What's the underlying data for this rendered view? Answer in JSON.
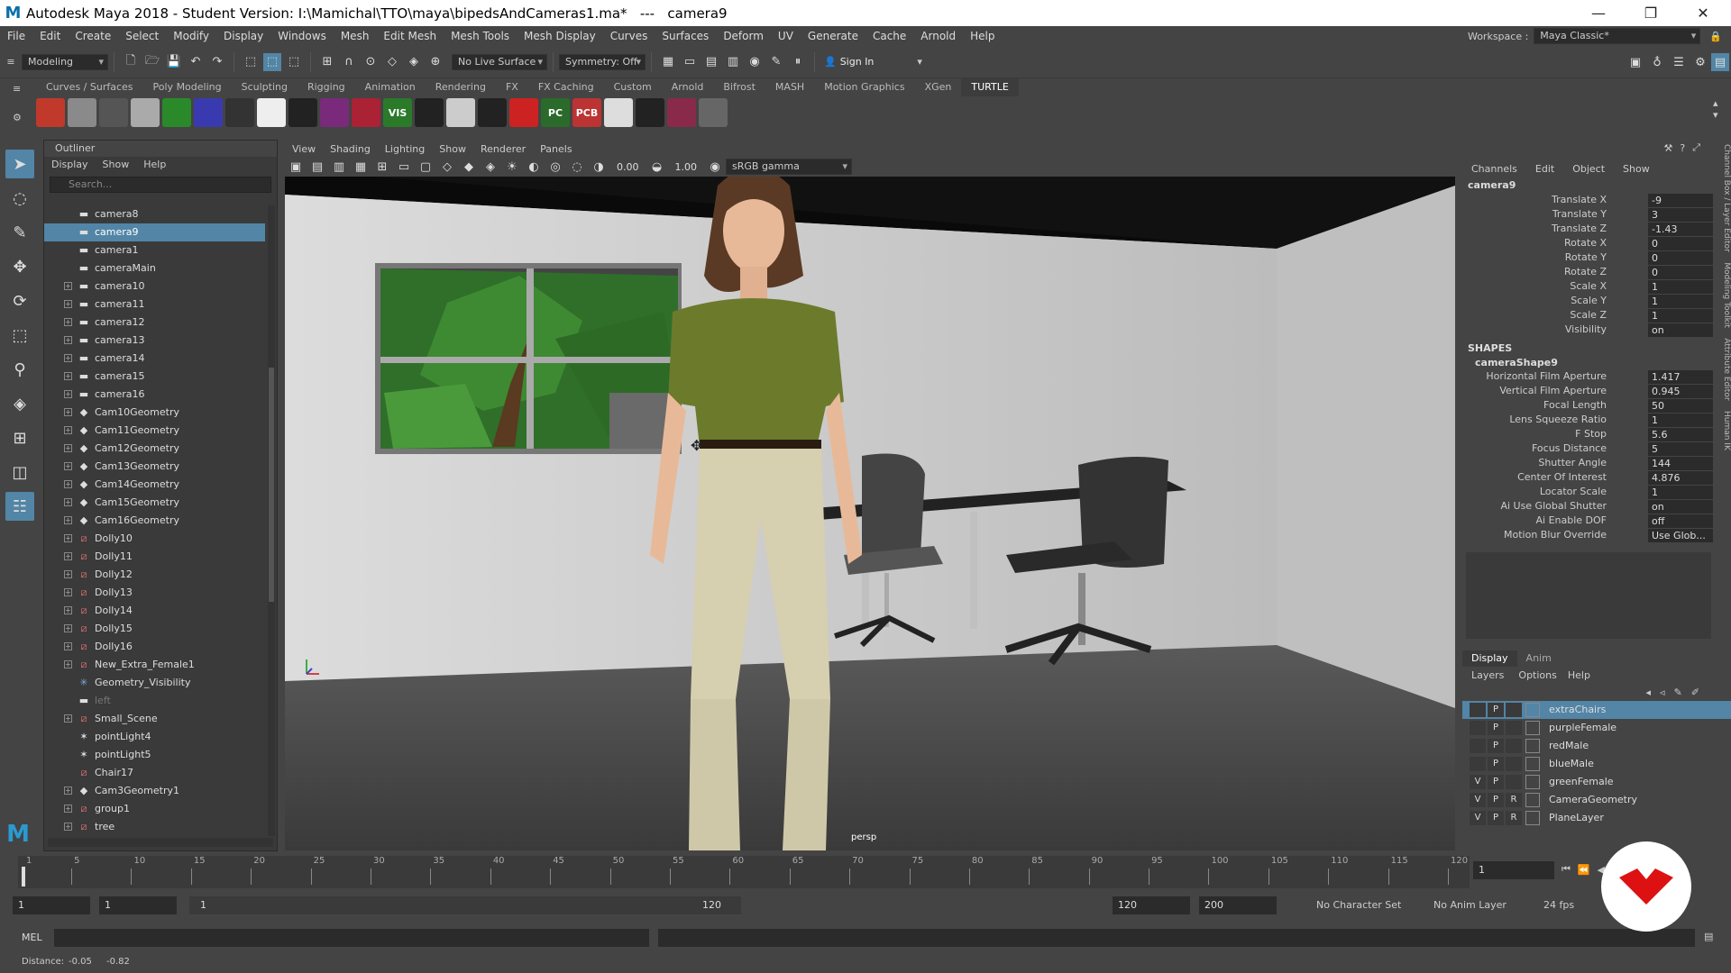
{
  "title": "Autodesk Maya 2018 - Student Version: I:\\Mamichal\\TTO\\maya\\bipedsAndCameras1.ma*   ---   camera9",
  "menus": [
    "File",
    "Edit",
    "Create",
    "Select",
    "Modify",
    "Display",
    "Windows",
    "Mesh",
    "Edit Mesh",
    "Mesh Tools",
    "Mesh Display",
    "Curves",
    "Surfaces",
    "Deform",
    "UV",
    "Generate",
    "Cache",
    "Arnold",
    "Help"
  ],
  "workspace": {
    "label": "Workspace :",
    "value": "Maya Classic*"
  },
  "status": {
    "mode": "Modeling",
    "live_surface": "No Live Surface",
    "symmetry": "Symmetry: Off",
    "sign_in": "Sign In"
  },
  "shelf_tabs": [
    "Curves / Surfaces",
    "Poly Modeling",
    "Sculpting",
    "Rigging",
    "Animation",
    "Rendering",
    "FX",
    "FX Caching",
    "Custom",
    "Arnold",
    "Bifrost",
    "MASH",
    "Motion Graphics",
    "XGen",
    "TURTLE"
  ],
  "shelf_colors": [
    "#c0392b",
    "#8a8a8a",
    "#555",
    "#aaa",
    "#2a8a2a",
    "#3a3ab0",
    "#333",
    "#eee",
    "#222",
    "#7a2a7a",
    "#aa2233",
    "#2a7a2a",
    "#222",
    "#ccc",
    "#222",
    "#cc2222",
    "#2a6a2a",
    "#b33",
    "#ddd",
    "#222",
    "#8a2a4a",
    "#666"
  ],
  "shelf_text": {
    "vis": "VIS",
    "pc": "PC",
    "pcb": "PCB"
  },
  "outliner": {
    "title": "Outliner",
    "menu": [
      "Display",
      "Show",
      "Help"
    ],
    "search_placeholder": "Search...",
    "items": [
      {
        "label": "camera8",
        "icon": "camera",
        "exp": false
      },
      {
        "label": "camera9",
        "icon": "camera",
        "exp": false,
        "sel": true
      },
      {
        "label": "camera1",
        "icon": "camera",
        "exp": false
      },
      {
        "label": "cameraMain",
        "icon": "camera",
        "exp": false
      },
      {
        "label": "camera10",
        "icon": "camera",
        "exp": true
      },
      {
        "label": "camera11",
        "icon": "camera",
        "exp": true
      },
      {
        "label": "camera12",
        "icon": "camera",
        "exp": true
      },
      {
        "label": "camera13",
        "icon": "camera",
        "exp": true
      },
      {
        "label": "camera14",
        "icon": "camera",
        "exp": true
      },
      {
        "label": "camera15",
        "icon": "camera",
        "exp": true
      },
      {
        "label": "camera16",
        "icon": "camera",
        "exp": true
      },
      {
        "label": "Cam10Geometry",
        "icon": "group",
        "exp": true
      },
      {
        "label": "Cam11Geometry",
        "icon": "group",
        "exp": true
      },
      {
        "label": "Cam12Geometry",
        "icon": "group",
        "exp": true
      },
      {
        "label": "Cam13Geometry",
        "icon": "group",
        "exp": true
      },
      {
        "label": "Cam14Geometry",
        "icon": "group",
        "exp": true
      },
      {
        "label": "Cam15Geometry",
        "icon": "group",
        "exp": true
      },
      {
        "label": "Cam16Geometry",
        "icon": "group",
        "exp": true
      },
      {
        "label": "Dolly10",
        "icon": "transform",
        "exp": true
      },
      {
        "label": "Dolly11",
        "icon": "transform",
        "exp": true
      },
      {
        "label": "Dolly12",
        "icon": "transform",
        "exp": true
      },
      {
        "label": "Dolly13",
        "icon": "transform",
        "exp": true
      },
      {
        "label": "Dolly14",
        "icon": "transform",
        "exp": true
      },
      {
        "label": "Dolly15",
        "icon": "transform",
        "exp": true
      },
      {
        "label": "Dolly16",
        "icon": "transform",
        "exp": true
      },
      {
        "label": "New_Extra_Female1",
        "icon": "transform",
        "exp": true
      },
      {
        "label": "Geometry_Visibility",
        "icon": "set",
        "exp": false
      },
      {
        "label": "left",
        "icon": "camera",
        "exp": false,
        "dim": true
      },
      {
        "label": "Small_Scene",
        "icon": "transform",
        "exp": true
      },
      {
        "label": "pointLight4",
        "icon": "light",
        "exp": false
      },
      {
        "label": "pointLight5",
        "icon": "light",
        "exp": false
      },
      {
        "label": "Chair17",
        "icon": "transform",
        "exp": false
      },
      {
        "label": "Cam3Geometry1",
        "icon": "group",
        "exp": true
      },
      {
        "label": "group1",
        "icon": "transform",
        "exp": true
      },
      {
        "label": "tree",
        "icon": "transform",
        "exp": true
      }
    ]
  },
  "viewport": {
    "menu": [
      "View",
      "Shading",
      "Lighting",
      "Show",
      "Renderer",
      "Panels"
    ],
    "exposure": "0.00",
    "gamma": "1.00",
    "colorspace": "sRGB gamma",
    "camera_label": "persp"
  },
  "channelbox": {
    "menu": [
      "Channels",
      "Edit",
      "Object",
      "Show"
    ],
    "object": "camera9",
    "attrs": [
      {
        "n": "Translate X",
        "v": "-9"
      },
      {
        "n": "Translate Y",
        "v": "3"
      },
      {
        "n": "Translate Z",
        "v": "-1.43"
      },
      {
        "n": "Rotate X",
        "v": "0"
      },
      {
        "n": "Rotate Y",
        "v": "0"
      },
      {
        "n": "Rotate Z",
        "v": "0"
      },
      {
        "n": "Scale X",
        "v": "1"
      },
      {
        "n": "Scale Y",
        "v": "1"
      },
      {
        "n": "Scale Z",
        "v": "1"
      },
      {
        "n": "Visibility",
        "v": "on"
      }
    ],
    "shapes_header": "SHAPES",
    "shape": "cameraShape9",
    "shape_attrs": [
      {
        "n": "Horizontal Film Aperture",
        "v": "1.417"
      },
      {
        "n": "Vertical Film Aperture",
        "v": "0.945"
      },
      {
        "n": "Focal Length",
        "v": "50"
      },
      {
        "n": "Lens Squeeze Ratio",
        "v": "1"
      },
      {
        "n": "F Stop",
        "v": "5.6"
      },
      {
        "n": "Focus Distance",
        "v": "5"
      },
      {
        "n": "Shutter Angle",
        "v": "144"
      },
      {
        "n": "Center Of Interest",
        "v": "4.876"
      },
      {
        "n": "Locator Scale",
        "v": "1"
      },
      {
        "n": "Ai Use Global Shutter",
        "v": "on"
      },
      {
        "n": "Ai Enable DOF",
        "v": "off"
      },
      {
        "n": "Motion Blur Override",
        "v": "Use Glob..."
      }
    ]
  },
  "layers": {
    "tabs": [
      "Display",
      "Anim"
    ],
    "menu": [
      "Layers",
      "Options",
      "Help"
    ],
    "items": [
      {
        "name": "extraChairs",
        "v": "",
        "p": "P",
        "r": "",
        "sel": true
      },
      {
        "name": "purpleFemale",
        "v": "",
        "p": "P",
        "r": ""
      },
      {
        "name": "redMale",
        "v": "",
        "p": "P",
        "r": ""
      },
      {
        "name": "blueMale",
        "v": "",
        "p": "P",
        "r": ""
      },
      {
        "name": "greenFemale",
        "v": "V",
        "p": "P",
        "r": ""
      },
      {
        "name": "CameraGeometry",
        "v": "V",
        "p": "P",
        "r": "R"
      },
      {
        "name": "PlaneLayer",
        "v": "V",
        "p": "P",
        "r": "R"
      }
    ]
  },
  "timeline": {
    "ticks": [
      "1",
      "5",
      "10",
      "15",
      "20",
      "25",
      "30",
      "35",
      "40",
      "45",
      "50",
      "55",
      "60",
      "65",
      "70",
      "75",
      "80",
      "85",
      "90",
      "95",
      "100",
      "105",
      "110",
      "115",
      "120"
    ],
    "current": "1",
    "range_start": "1",
    "range_start2": "1",
    "range_thumb_start": "1",
    "range_thumb_end": "120",
    "anim_end": "120",
    "anim_end2": "200",
    "character_set": "No Character Set",
    "anim_layer": "No Anim Layer",
    "fps": "24 fps"
  },
  "cmdline": {
    "label": "MEL"
  },
  "helpline": {
    "label": "Distance:",
    "x": "-0.05",
    "y": "-0.82"
  }
}
